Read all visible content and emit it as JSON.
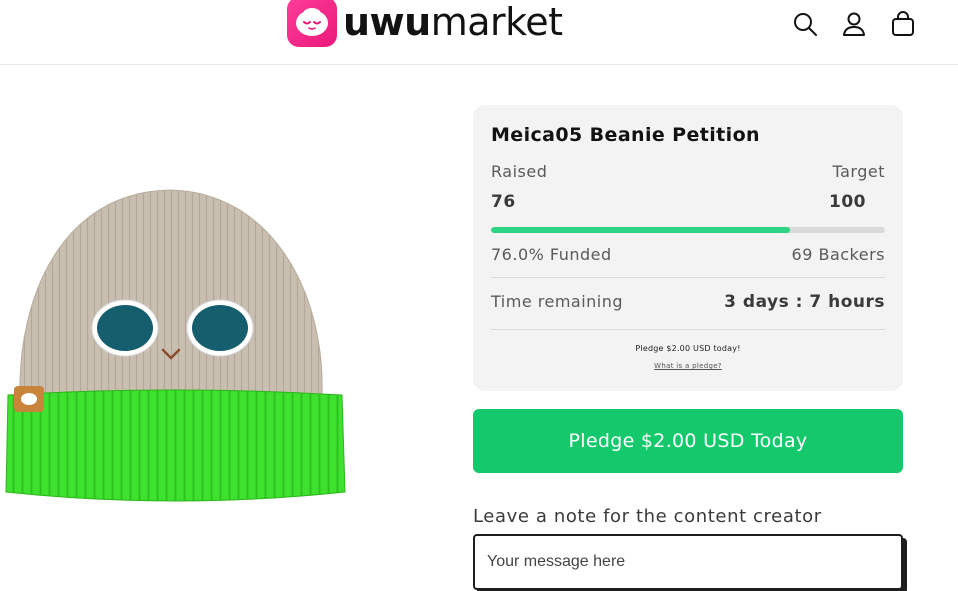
{
  "header": {
    "logo_bold": "uwu",
    "logo_light": "market",
    "icons": [
      "search-icon",
      "account-icon",
      "cart-icon"
    ]
  },
  "campaign": {
    "title": "Meica05 Beanie Petition",
    "raised_label": "Raised",
    "raised_value": "76",
    "target_label": "Target",
    "target_value": "100",
    "funded_fraction": 0.76,
    "funded_text": "76.0% Funded",
    "backers_text": "69 Backers",
    "time_label": "Time remaining",
    "time_value": "3 days : 7 hours",
    "pledge_note": "Pledge $2.00 USD today!",
    "pledge_link": "What is a pledge?"
  },
  "pledge_button": {
    "label": "Pledge $2.00 USD Today"
  },
  "note": {
    "label": "Leave a note for the content creator",
    "placeholder": "Your message here",
    "value": ""
  },
  "colors": {
    "accent": "#13c96c",
    "progress": "#2fd483",
    "logo": "#e9197a",
    "card_bg": "#f3f3f3"
  }
}
